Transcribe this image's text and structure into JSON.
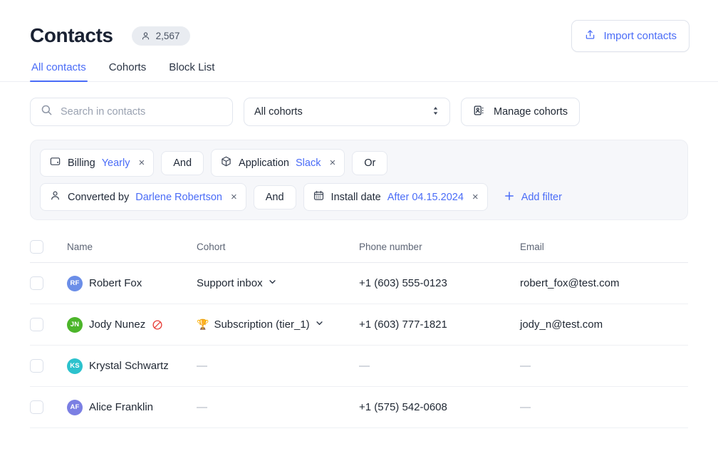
{
  "header": {
    "title": "Contacts",
    "count_badge": {
      "icon": "person-icon",
      "value": "2,567"
    },
    "import_button": {
      "label": "Import contacts",
      "icon": "upload-icon"
    }
  },
  "tabs": [
    {
      "label": "All contacts",
      "active": true
    },
    {
      "label": "Cohorts",
      "active": false
    },
    {
      "label": "Block List",
      "active": false
    }
  ],
  "controls": {
    "search": {
      "placeholder": "Search in contacts",
      "value": "",
      "icon": "search-icon"
    },
    "cohort_select": {
      "value": "All cohorts",
      "icon": "chevron-updown-icon"
    },
    "manage_cohorts": {
      "label": "Manage cohorts",
      "icon": "contact-card-icon"
    }
  },
  "filters": {
    "rows": [
      {
        "chips": [
          {
            "icon": "wallet-icon",
            "field": "Billing",
            "value": "Yearly",
            "close": "×"
          }
        ],
        "logic": "And",
        "chips2": [
          {
            "icon": "cube-icon",
            "field": "Application",
            "value": "Slack",
            "close": "×"
          }
        ],
        "logic2": "Or"
      },
      {
        "chips": [
          {
            "icon": "person-icon",
            "field": "Converted by",
            "value": "Darlene Robertson",
            "close": "×"
          }
        ],
        "logic": "And",
        "chips2": [
          {
            "icon": "calendar-icon",
            "field": "Install date",
            "value": "After 04.15.2024",
            "close": "×"
          }
        ]
      }
    ],
    "add_filter": {
      "label": "Add filter",
      "icon": "plus-icon"
    }
  },
  "table": {
    "columns": [
      "Name",
      "Cohort",
      "Phone number",
      "Email"
    ],
    "rows": [
      {
        "initials": "RF",
        "avatar_color": "#6b8ee8",
        "name": "Robert Fox",
        "blocked": false,
        "cohort": "Support inbox",
        "cohort_trophy": false,
        "phone": "+1 (603) 555-0123",
        "email": "robert_fox@test.com"
      },
      {
        "initials": "JN",
        "avatar_color": "#4cb52a",
        "name": "Jody Nunez",
        "blocked": true,
        "cohort": "Subscription (tier_1)",
        "cohort_trophy": true,
        "trophy": "🏆",
        "phone": "+1 (603) 777-1821",
        "email": "jody_n@test.com"
      },
      {
        "initials": "KS",
        "avatar_color": "#2cc2cd",
        "name": "Krystal Schwartz",
        "blocked": false,
        "cohort": "—",
        "cohort_trophy": false,
        "phone": "—",
        "email": "—"
      },
      {
        "initials": "AF",
        "avatar_color": "#7b7fe3",
        "name": "Alice Franklin",
        "blocked": false,
        "cohort": "—",
        "cohort_trophy": false,
        "phone": "+1 (575) 542-0608",
        "email": "—"
      }
    ]
  },
  "colors": {
    "accent": "#4a6cf7",
    "text": "#1f2733",
    "muted": "#5d6575",
    "blocked": "#e8413c",
    "panel_bg": "#f6f7fa",
    "border": "#e2e6ee"
  }
}
